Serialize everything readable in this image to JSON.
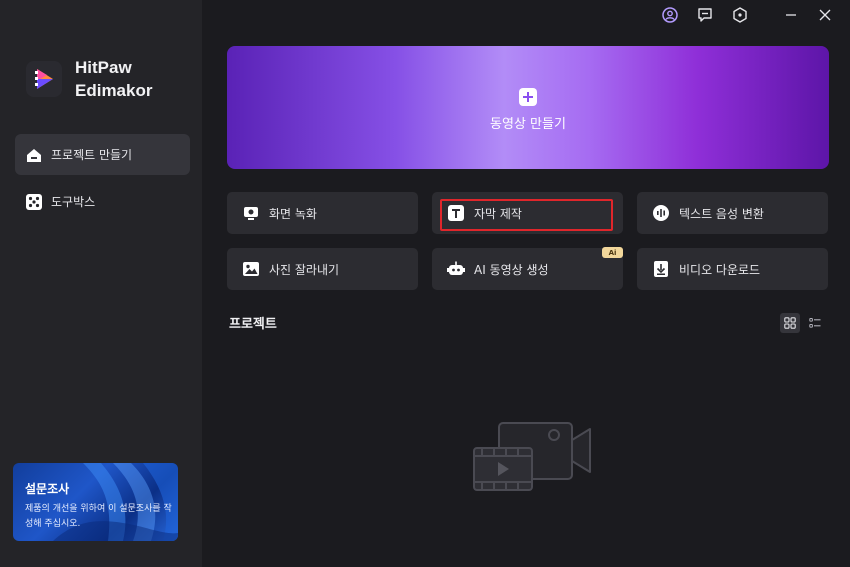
{
  "window": {
    "controls": [
      "user-icon",
      "feedback-icon",
      "settings-icon",
      "minimize-icon",
      "close-icon"
    ]
  },
  "sidebar": {
    "brand_line1": "HitPaw",
    "brand_line2": "Edimakor",
    "items": [
      {
        "label": "프로젝트 만들기",
        "icon": "home-icon",
        "active": true
      },
      {
        "label": "도구박스",
        "icon": "toolbox-icon",
        "active": false
      }
    ],
    "survey": {
      "title": "설문조사",
      "text": "제품의 개선을 위하여 이 설문조사를 작성해 주십시오."
    }
  },
  "hero": {
    "label": "동영상 만들기",
    "icon": "plus-icon"
  },
  "tools": [
    {
      "label": "화면 녹화",
      "icon": "screen-record-icon"
    },
    {
      "label": "자막 제작",
      "icon": "text-icon"
    },
    {
      "label": "텍스트 음성 변환",
      "icon": "voice-icon"
    },
    {
      "label": "사진 잘라내기",
      "icon": "image-cut-icon"
    },
    {
      "label": "AI 동영상 생성",
      "icon": "robot-icon",
      "badge": "Ai"
    },
    {
      "label": "비디오 다운로드",
      "icon": "download-icon"
    }
  ],
  "projects": {
    "title": "프로젝트",
    "view_modes": [
      "grid-view-icon",
      "list-view-icon"
    ],
    "selected_view": "grid"
  },
  "colors": {
    "background": "#1b1b1f",
    "sidebar": "#242428",
    "card": "#2c2c31",
    "highlight": "#e0262b",
    "hero_purple": "#8650e6"
  }
}
